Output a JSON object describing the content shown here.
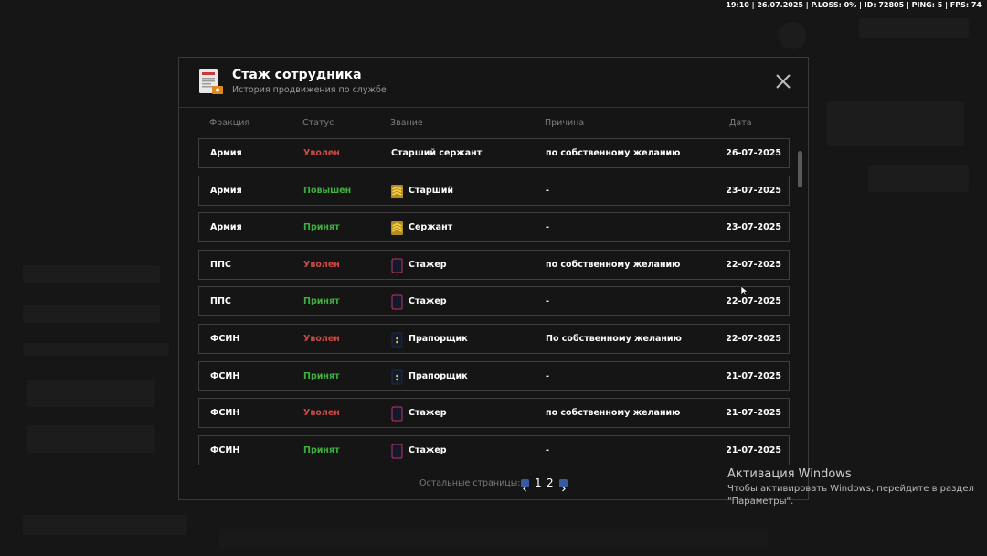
{
  "status_bar": "19:10 | 26.07.2025 | P.LOSS: 0% | ID: 72805 | PING: 5 | FPS: 74",
  "modal": {
    "title": "Стаж сотрудника",
    "subtitle": "История продвижения по службе",
    "icon": "document-certificate-icon",
    "close_icon": "close-icon"
  },
  "columns": {
    "faction": "Фракция",
    "status": "Статус",
    "rank": "Звание",
    "reason": "Причина",
    "date": "Дата"
  },
  "rows": [
    {
      "faction": "Армия",
      "status": "Уволен",
      "status_type": "fired",
      "rank": "Старший сержант",
      "rank_icon": "none",
      "reason": "по собственному желанию",
      "date": "26-07-2025"
    },
    {
      "faction": "Армия",
      "status": "Повышен",
      "status_type": "promoted",
      "rank": "Старший",
      "rank_icon": "army-stripes-icon",
      "reason": "-",
      "date": "23-07-2025"
    },
    {
      "faction": "Армия",
      "status": "Принят",
      "status_type": "hired",
      "rank": "Сержант",
      "rank_icon": "army-stripes-icon",
      "reason": "-",
      "date": "23-07-2025"
    },
    {
      "faction": "ППС",
      "status": "Уволен",
      "status_type": "fired",
      "rank": "Стажер",
      "rank_icon": "epaulette-plain-icon",
      "reason": "по собственному желанию",
      "date": "22-07-2025"
    },
    {
      "faction": "ППС",
      "status": "Принят",
      "status_type": "hired",
      "rank": "Стажер",
      "rank_icon": "epaulette-plain-icon",
      "reason": "-",
      "date": "22-07-2025"
    },
    {
      "faction": "ФСИН",
      "status": "Уволен",
      "status_type": "fired",
      "rank": "Прапорщик",
      "rank_icon": "epaulette-stars-icon",
      "reason": "По собственному желанию",
      "date": "22-07-2025"
    },
    {
      "faction": "ФСИН",
      "status": "Принят",
      "status_type": "hired",
      "rank": "Прапорщик",
      "rank_icon": "epaulette-stars-icon",
      "reason": "-",
      "date": "21-07-2025"
    },
    {
      "faction": "ФСИН",
      "status": "Уволен",
      "status_type": "fired",
      "rank": "Стажер",
      "rank_icon": "epaulette-plain-icon",
      "reason": "по собственному желанию",
      "date": "21-07-2025"
    },
    {
      "faction": "ФСИН",
      "status": "Принят",
      "status_type": "hired",
      "rank": "Стажер",
      "rank_icon": "epaulette-plain-icon",
      "reason": "-",
      "date": "21-07-2025"
    }
  ],
  "pager": {
    "label": "Остальные страницы:",
    "pages": [
      "1",
      "2"
    ],
    "current": "1"
  },
  "watermark": {
    "title": "Активация Windows",
    "subtitle": "Чтобы активировать Windows, перейдите в раздел \"Параметры\"."
  },
  "colors": {
    "fired": "#c94a46",
    "promoted": "#3fae3f",
    "hired": "#3fae3f",
    "accent": "#3a5aa0"
  }
}
